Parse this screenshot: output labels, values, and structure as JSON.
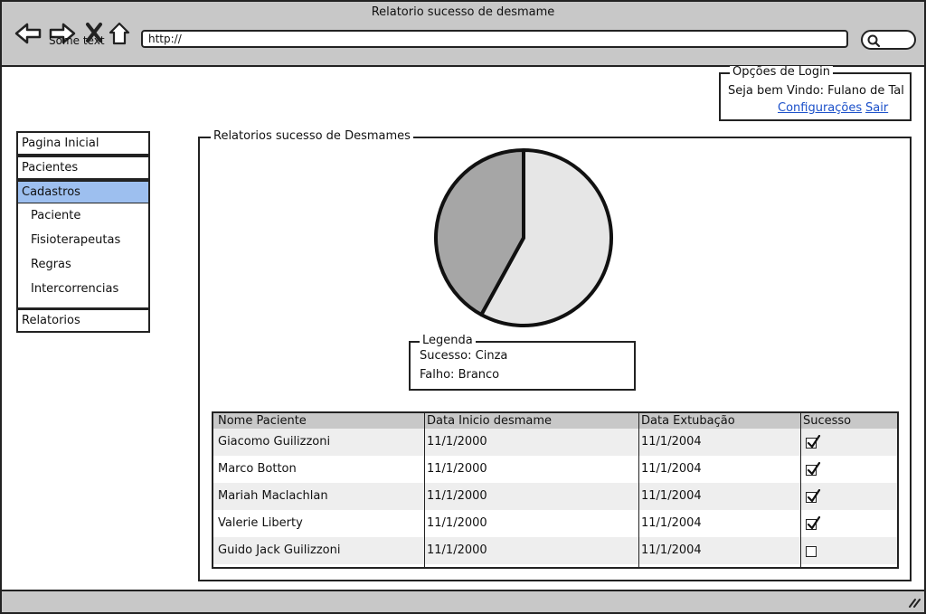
{
  "window": {
    "title": "Relatorio sucesso de desmame"
  },
  "toolbar": {
    "overlay_text": "Some text",
    "url": "http://",
    "icons": [
      "back-arrow-icon",
      "forward-arrow-icon",
      "close-x-icon",
      "home-icon",
      "search-icon"
    ]
  },
  "login": {
    "legend": "Opções de Login",
    "welcome": "Seja bem Vindo: Fulano de Tal",
    "settings_link": "Configurações",
    "logout_link": "Sair"
  },
  "sidebar": {
    "items": [
      {
        "label": "Pagina Inicial"
      },
      {
        "label": "Pacientes"
      },
      {
        "label": "Cadastros"
      },
      {
        "label": "Relatorios"
      }
    ],
    "submenu": [
      {
        "label": "Paciente"
      },
      {
        "label": "Fisioterapeutas"
      },
      {
        "label": "Regras"
      },
      {
        "label": "Intercorrencias"
      }
    ],
    "active_index": 2,
    "active_color": "#9dbfef"
  },
  "report": {
    "legend": "Relatorios sucesso de Desmames",
    "legend_box": {
      "title": "Legenda",
      "lines": [
        "Sucesso: Cinza",
        "Falho: Branco"
      ]
    }
  },
  "chart_data": {
    "type": "pie",
    "slices": [
      {
        "label": "Sucesso",
        "value": 42,
        "color": "#a6a6a6"
      },
      {
        "label": "Falho",
        "value": 58,
        "color": "#e6e6e6"
      }
    ]
  },
  "table": {
    "columns": [
      "Nome Paciente",
      "Data Inicio desmame",
      "Data Extubação",
      "Sucesso"
    ],
    "rows": [
      {
        "name": "Giacomo Guilizzoni",
        "start": "11/1/2000",
        "extubation": "11/1/2004",
        "success": true
      },
      {
        "name": "Marco Botton",
        "start": "11/1/2000",
        "extubation": "11/1/2004",
        "success": true
      },
      {
        "name": "Mariah Maclachlan",
        "start": "11/1/2000",
        "extubation": "11/1/2004",
        "success": true
      },
      {
        "name": "Valerie Liberty",
        "start": "11/1/2000",
        "extubation": "11/1/2004",
        "success": true
      },
      {
        "name": "Guido Jack Guilizzoni",
        "start": "11/1/2000",
        "extubation": "11/1/2004",
        "success": false
      }
    ]
  }
}
